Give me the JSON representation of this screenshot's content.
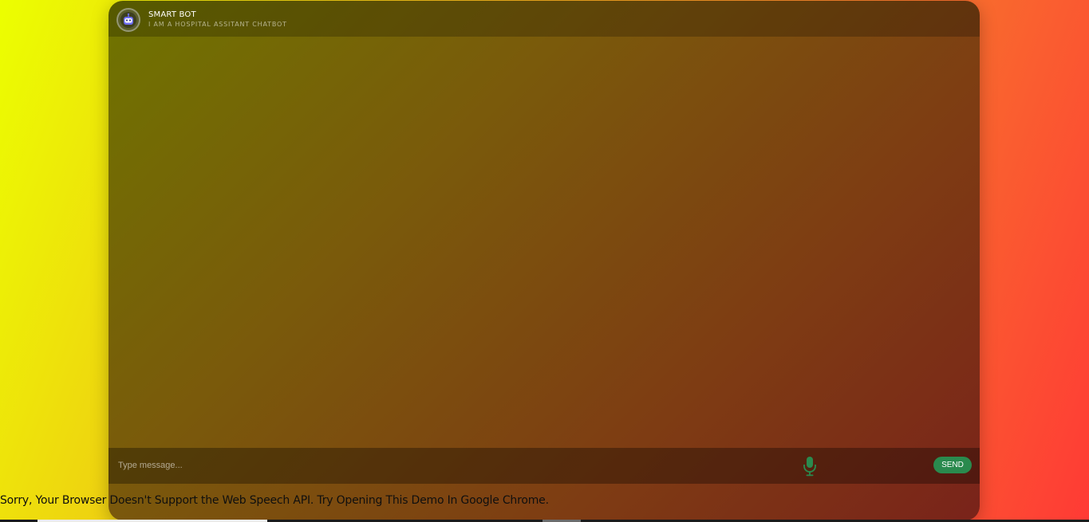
{
  "header": {
    "title": "SMART BOT",
    "subtitle": "I AM A HOSPITAL ASSITANT CHATBOT",
    "avatar_icon": "robot-icon"
  },
  "composer": {
    "input_placeholder": "Type message...",
    "input_value": "",
    "mic_icon": "microphone-icon",
    "send_label": "SEND"
  },
  "notice": {
    "speech_error": "Sorry, Your Browser Doesn't Support the Web Speech API. Try Opening This Demo In Google Chrome."
  },
  "colors": {
    "send_button": "#2a8a4e",
    "mic_icon": "#2a8a4e",
    "avatar_face": "#6c6cf0"
  }
}
